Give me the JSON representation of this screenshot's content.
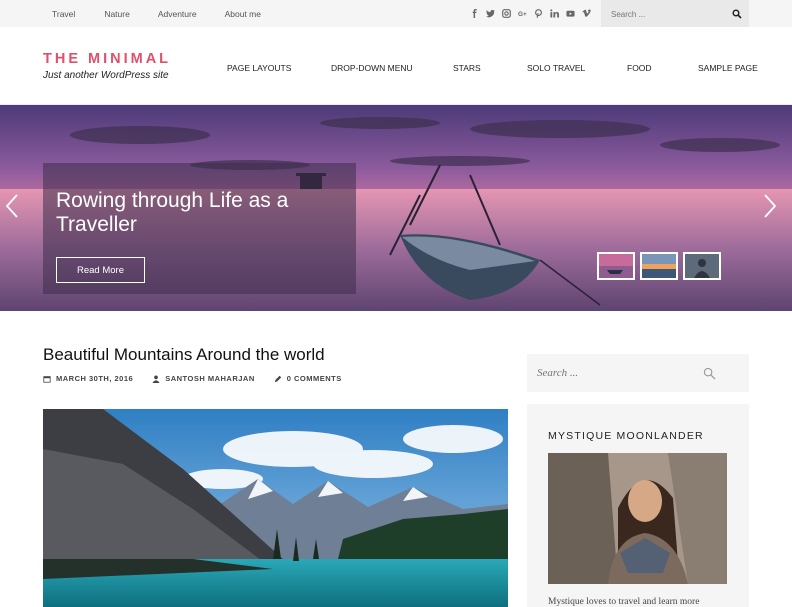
{
  "topbar": {
    "links": [
      "Travel",
      "Nature",
      "Adventure",
      "About me"
    ],
    "social_icons": [
      "facebook-icon",
      "twitter-icon",
      "instagram-icon",
      "google-plus-icon",
      "pinterest-icon",
      "linkedin-icon",
      "youtube-icon",
      "vimeo-icon"
    ],
    "search_placeholder": "Search ..."
  },
  "header": {
    "site_title": "THE MINIMAL",
    "tagline": "Just another WordPress site",
    "nav": [
      "PAGE LAYOUTS",
      "DROP-DOWN MENU",
      "STARS",
      "SOLO TRAVEL",
      "FOOD",
      "SAMPLE PAGE"
    ]
  },
  "slider": {
    "caption_title": "Rowing through Life as a Traveller",
    "button_label": "Read More"
  },
  "post": {
    "title": "Beautiful Mountains Around the world",
    "date": "MARCH 30TH, 2016",
    "author": "SANTOSH MAHARJAN",
    "comments": "0 COMMENTS"
  },
  "sidebar": {
    "search_placeholder": "Search ...",
    "widget_title": "MYSTIQUE MOONLANDER",
    "bio": "Mystique loves to travel and learn more"
  },
  "colors": {
    "accent": "#e0506c",
    "topbar_bg": "#f5f5f5",
    "widget_bg": "#f5f5f5"
  }
}
